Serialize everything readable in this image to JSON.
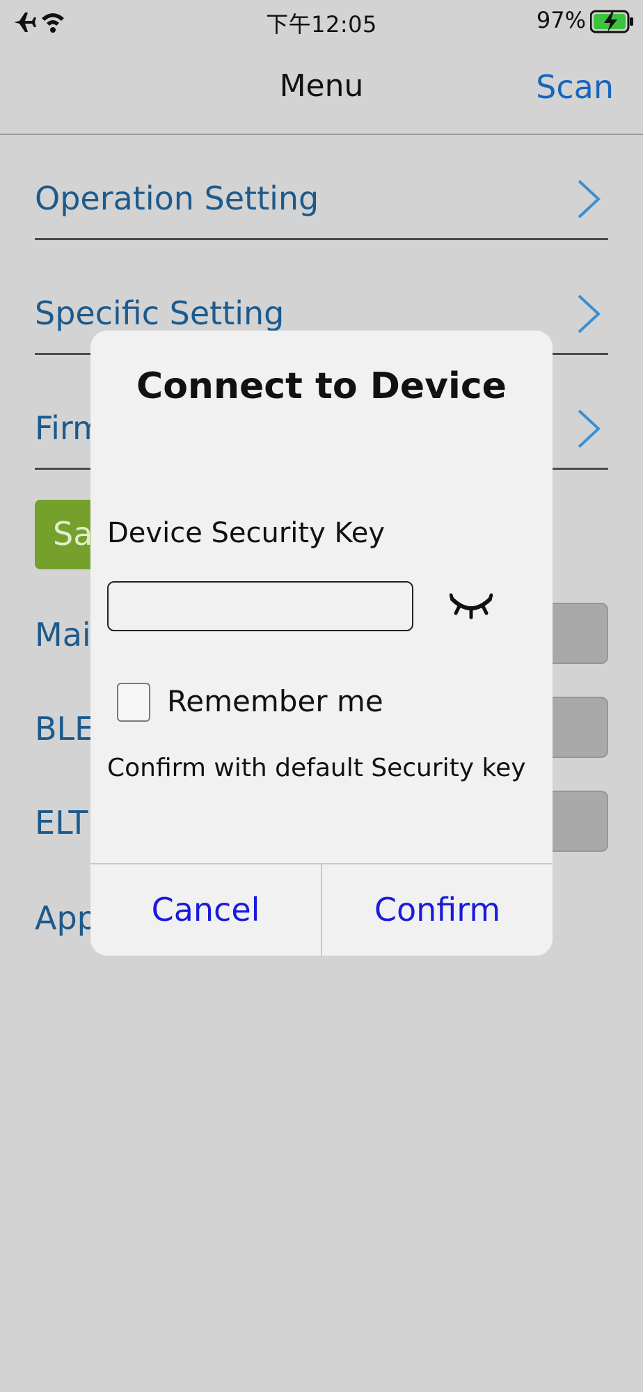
{
  "status_bar": {
    "left_icons": [
      "airplane-icon",
      "wifi-icon"
    ],
    "time": "下午12:05",
    "battery_percent": "97%",
    "battery_icon": "battery-charging-icon"
  },
  "nav": {
    "title": "Menu",
    "scan_label": "Scan"
  },
  "menu": {
    "items": [
      {
        "label": "Operation Setting",
        "icon": "chevron-right-icon"
      },
      {
        "label": "Specific Setting",
        "icon": "chevron-right-icon"
      },
      {
        "label": "Firm",
        "icon": "chevron-right-icon"
      }
    ],
    "save_label": "Sa",
    "info_rows": [
      {
        "label": "Mai"
      },
      {
        "label": "BLE"
      },
      {
        "label": "ELTF"
      },
      {
        "label": "App"
      }
    ]
  },
  "dialog": {
    "title": "Connect to Device",
    "key_label": "Device Security Key",
    "key_value": "",
    "eye_icon": "eye-closed-icon",
    "remember_label": "Remember me",
    "remember_checked": false,
    "default_key_text": "Confirm with default Security key",
    "cancel_label": "Cancel",
    "confirm_label": "Confirm"
  },
  "colors": {
    "background": "#d3d3d3",
    "link_blue": "#1565c0",
    "menu_text": "#1d5a8c",
    "save_green": "#75a02c",
    "dialog_button_blue": "#1a1adb",
    "dialog_bg": "#f1f1f1"
  }
}
